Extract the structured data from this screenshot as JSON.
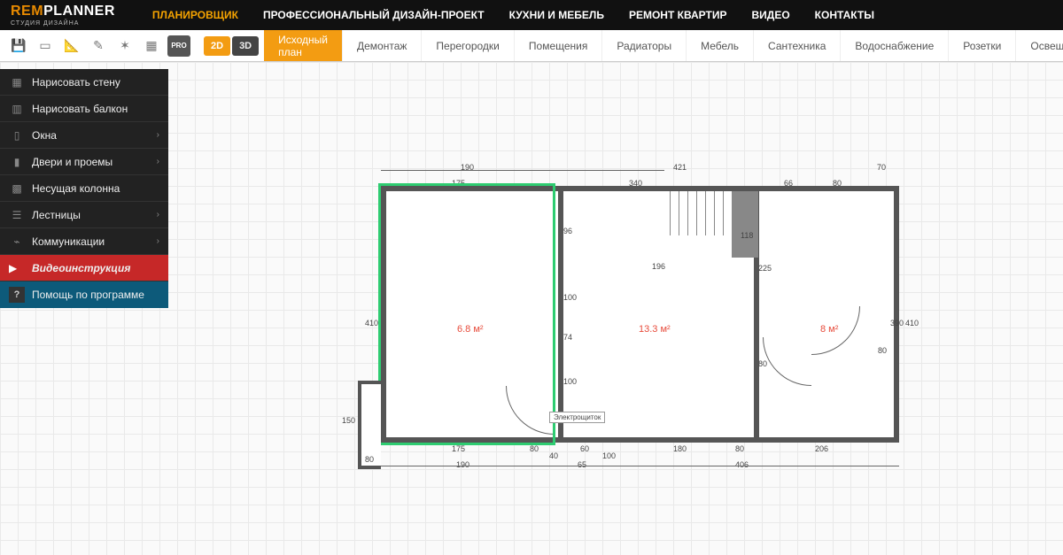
{
  "logo": {
    "part1": "REM",
    "part2": "PLANNER",
    "sub": "СТУДИЯ ДИЗАЙНА"
  },
  "nav": {
    "planner": "ПЛАНИРОВЩИК",
    "design": "ПРОФЕССИОНАЛЬНЫЙ ДИЗАЙН-ПРОЕКТ",
    "kitchen": "КУХНИ И МЕБЕЛЬ",
    "renovation": "РЕМОНТ КВАРТИР",
    "video": "ВИДЕО",
    "contacts": "КОНТАКТЫ"
  },
  "view": {
    "twoD": "2D",
    "threeD": "3D",
    "pro": "PRO"
  },
  "tabs": {
    "source": "Исходный план",
    "demolition": "Демонтаж",
    "partitions": "Перегородки",
    "rooms": "Помещения",
    "radiators": "Радиаторы",
    "furniture": "Мебель",
    "plumbing": "Сантехника",
    "water": "Водоснабжение",
    "sockets": "Розетки",
    "lighting": "Освещение"
  },
  "side": {
    "wall": "Нарисовать стену",
    "balcony": "Нарисовать балкон",
    "windows": "Окна",
    "doors": "Двери и проемы",
    "column": "Несущая колонна",
    "stairs": "Лестницы",
    "comms": "Коммуникации",
    "video": "Видеоинструкция",
    "help": "Помощь по программе"
  },
  "plan": {
    "room1": "6.8 м²",
    "room2": "13.3 м²",
    "room3": "8 м²",
    "panel_label": "Электрощиток",
    "dims": {
      "top_190": "190",
      "top_175": "175",
      "top_421": "421",
      "top_340": "340",
      "top_66": "66",
      "top_70": "70",
      "top_80": "80",
      "left_410": "410",
      "left_150": "150",
      "left_80b": "80",
      "right_390": "390",
      "right_410": "410",
      "inner_96": "96",
      "inner_100a": "100",
      "inner_74": "74",
      "inner_100b": "100",
      "inner_196": "196",
      "inner_118": "118",
      "inner_225": "225",
      "inner_80d1": "80",
      "inner_80d2": "80",
      "bot_175": "175",
      "bot_80": "80",
      "bot_65": "65",
      "bot_100": "100",
      "bot_60": "60",
      "bot_180": "180",
      "bot_80b": "80",
      "bot_206": "206",
      "bot_190": "190",
      "bot_406": "406",
      "bot_40": "40"
    }
  }
}
